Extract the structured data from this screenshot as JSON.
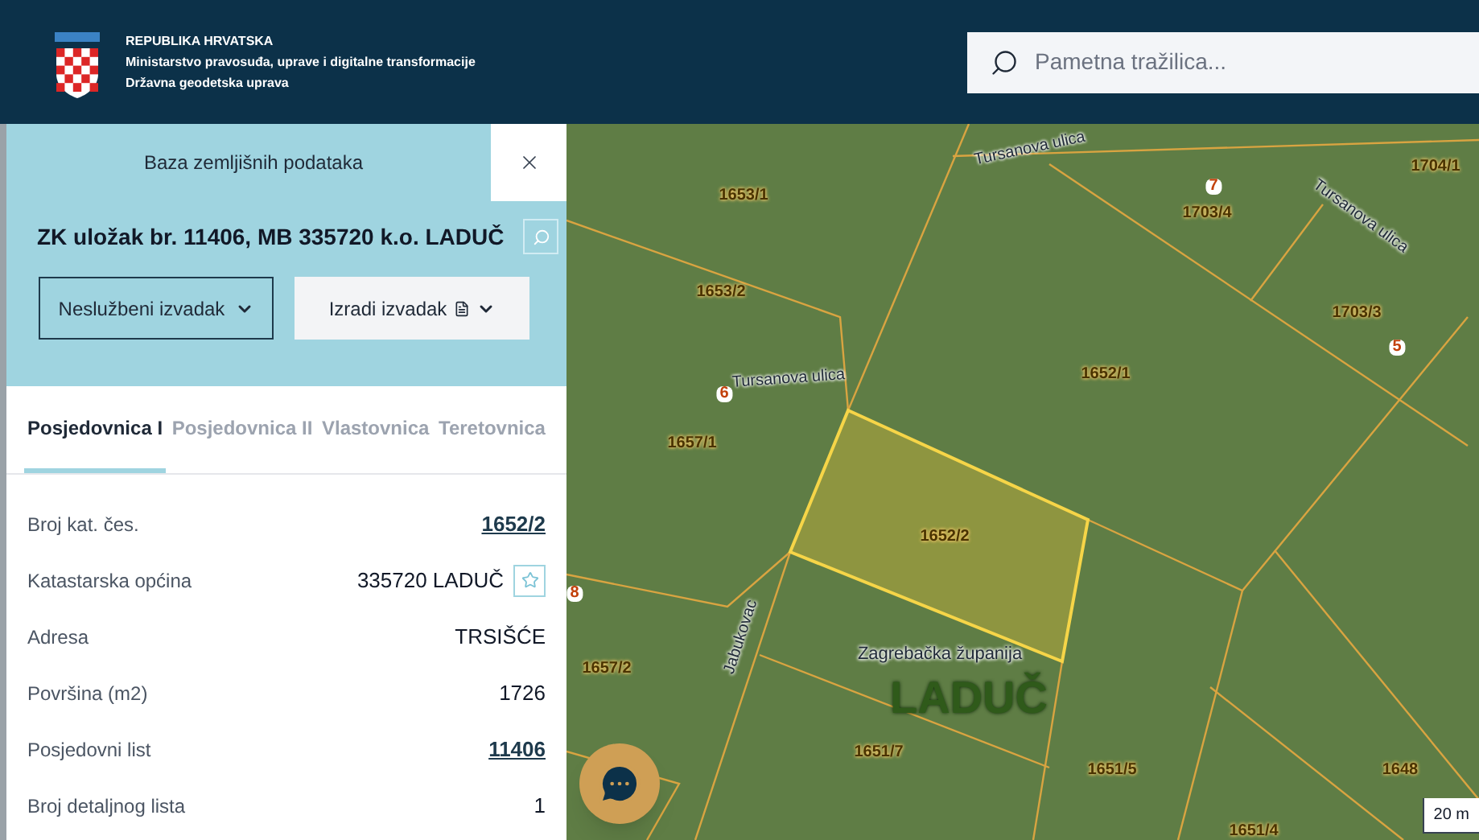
{
  "header": {
    "lines": [
      "REPUBLIKA HRVATSKA",
      "Ministarstvo pravosuđa, uprave i digitalne transformacije",
      "Državna geodetska uprava"
    ],
    "search": {
      "placeholder": "Pametna tražilica..."
    }
  },
  "panel": {
    "title": "Baza zemljišnih podataka",
    "heading": "ZK uložak br. 11406, MB 335720 k.o. LADUČ",
    "buttons": [
      {
        "label": "Neslužbeni izvadak",
        "kind": "outline"
      },
      {
        "label": "Izradi izvadak",
        "kind": "document"
      }
    ],
    "tabs": [
      {
        "label": "Posjedovnica I",
        "selected": true
      },
      {
        "label": "Posjedovnica II",
        "selected": false
      },
      {
        "label": "Vlastovnica",
        "selected": false
      },
      {
        "label": "Teretovnica",
        "selected": false
      }
    ],
    "rows": [
      {
        "label": "Broj kat. čes.",
        "value": "1652/2",
        "kind": "link"
      },
      {
        "label": "Katastarska općina",
        "value": "335720 LADUČ",
        "kind": "text",
        "starred": false
      },
      {
        "label": "Adresa",
        "value": "TRSIŠĆE",
        "kind": "text"
      },
      {
        "label": "Površina (m2)",
        "value": "1726",
        "kind": "text"
      },
      {
        "label": "Posjedovni list",
        "value": "11406",
        "kind": "link"
      },
      {
        "label": "Broj detaljnog lista",
        "value": "1",
        "kind": "text"
      }
    ]
  },
  "map": {
    "labels": [
      {
        "text": "Tursanova ulica",
        "kind": "street"
      },
      {
        "text": "Tursanova ulica",
        "kind": "street"
      },
      {
        "text": "Tursanova ulica",
        "kind": "street"
      },
      {
        "text": "Jabukovac",
        "kind": "street"
      },
      {
        "text": "1653/1",
        "kind": "parcel"
      },
      {
        "text": "1704/1",
        "kind": "parcel"
      },
      {
        "text": "7",
        "kind": "house"
      },
      {
        "text": "1703/4",
        "kind": "parcel"
      },
      {
        "text": "1653/2",
        "kind": "parcel"
      },
      {
        "text": "1703/3",
        "kind": "parcel"
      },
      {
        "text": "5",
        "kind": "house"
      },
      {
        "text": "1652/1",
        "kind": "parcel"
      },
      {
        "text": "6",
        "kind": "house"
      },
      {
        "text": "1657/1",
        "kind": "parcel"
      },
      {
        "text": "1652/2",
        "kind": "parcel"
      },
      {
        "text": "8",
        "kind": "house"
      },
      {
        "text": "Zagrebačka županija",
        "kind": "region"
      },
      {
        "text": "1657/2",
        "kind": "parcel"
      },
      {
        "text": "LADUČ",
        "kind": "place"
      },
      {
        "text": "1651/7",
        "kind": "parcel"
      },
      {
        "text": "1651/5",
        "kind": "parcel"
      },
      {
        "text": "1648",
        "kind": "parcel"
      },
      {
        "text": "1651/4",
        "kind": "parcel"
      }
    ],
    "scale": "20 m"
  }
}
